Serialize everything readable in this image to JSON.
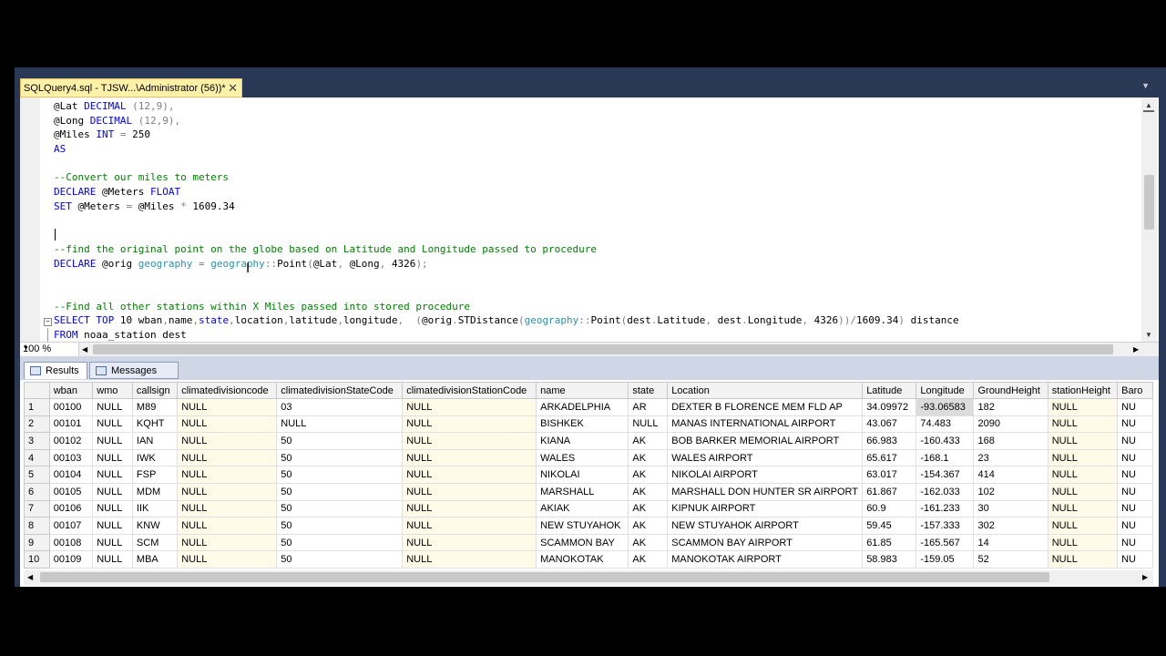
{
  "document_tab": {
    "title": "SQLQuery4.sql - TJSW...\\Administrator (56))*",
    "close": "✕"
  },
  "code_lines": [
    [
      {
        "t": "@Lat ",
        "c": "vr"
      },
      {
        "t": "DECIMAL",
        "c": "kw"
      },
      {
        "t": " (12,9),",
        "c": "op"
      }
    ],
    [
      {
        "t": "@Long ",
        "c": "vr"
      },
      {
        "t": "DECIMAL",
        "c": "kw"
      },
      {
        "t": " (12,9),",
        "c": "op"
      }
    ],
    [
      {
        "t": "@Miles ",
        "c": "vr"
      },
      {
        "t": "INT",
        "c": "kw"
      },
      {
        "t": " = ",
        "c": "op"
      },
      {
        "t": "250",
        "c": "vr"
      }
    ],
    [
      {
        "t": "AS",
        "c": "kw"
      }
    ],
    [],
    [
      {
        "t": "--Convert our miles to meters",
        "c": "cm"
      }
    ],
    [
      {
        "t": "DECLARE",
        "c": "kw"
      },
      {
        "t": " @Meters ",
        "c": "vr"
      },
      {
        "t": "FLOAT",
        "c": "kw"
      }
    ],
    [
      {
        "t": "SET",
        "c": "kw"
      },
      {
        "t": " @Meters ",
        "c": "vr"
      },
      {
        "t": "=",
        "c": "op"
      },
      {
        "t": " @Miles ",
        "c": "vr"
      },
      {
        "t": "*",
        "c": "op"
      },
      {
        "t": " 1609.34",
        "c": "vr"
      }
    ],
    [],
    [],
    [
      {
        "t": "--find the original point on the globe based on Latitude and Longitude passed to procedure",
        "c": "cm"
      }
    ],
    [
      {
        "t": "DECLARE",
        "c": "kw"
      },
      {
        "t": " @orig ",
        "c": "vr"
      },
      {
        "t": "geography",
        "c": "ty"
      },
      {
        "t": " = ",
        "c": "op"
      },
      {
        "t": "geography",
        "c": "ty"
      },
      {
        "t": "::",
        "c": "op"
      },
      {
        "t": "Point",
        "c": "vr"
      },
      {
        "t": "(",
        "c": "op"
      },
      {
        "t": "@Lat",
        "c": "vr"
      },
      {
        "t": ", ",
        "c": "op"
      },
      {
        "t": "@Long",
        "c": "vr"
      },
      {
        "t": ", ",
        "c": "op"
      },
      {
        "t": "4326",
        "c": "vr"
      },
      {
        "t": ");",
        "c": "op"
      }
    ],
    [],
    [],
    [
      {
        "t": "--Find all other stations within X Miles passed into stored procedure",
        "c": "cm"
      }
    ],
    [
      {
        "t": "SELECT TOP",
        "c": "kw"
      },
      {
        "t": " 10 wban",
        "c": "vr"
      },
      {
        "t": ",",
        "c": "op"
      },
      {
        "t": "name",
        "c": "vr"
      },
      {
        "t": ",",
        "c": "op"
      },
      {
        "t": "state",
        "c": "kw"
      },
      {
        "t": ",",
        "c": "op"
      },
      {
        "t": "location",
        "c": "vr"
      },
      {
        "t": ",",
        "c": "op"
      },
      {
        "t": "latitude",
        "c": "vr"
      },
      {
        "t": ",",
        "c": "op"
      },
      {
        "t": "longitude",
        "c": "vr"
      },
      {
        "t": ",  (",
        "c": "op"
      },
      {
        "t": "@orig",
        "c": "vr"
      },
      {
        "t": ".",
        "c": "op"
      },
      {
        "t": "STDistance",
        "c": "vr"
      },
      {
        "t": "(",
        "c": "op"
      },
      {
        "t": "geography",
        "c": "ty"
      },
      {
        "t": "::",
        "c": "op"
      },
      {
        "t": "Point",
        "c": "vr"
      },
      {
        "t": "(",
        "c": "op"
      },
      {
        "t": "dest",
        "c": "vr"
      },
      {
        "t": ".",
        "c": "op"
      },
      {
        "t": "Latitude",
        "c": "vr"
      },
      {
        "t": ", ",
        "c": "op"
      },
      {
        "t": "dest",
        "c": "vr"
      },
      {
        "t": ".",
        "c": "op"
      },
      {
        "t": "Longitude",
        "c": "vr"
      },
      {
        "t": ", ",
        "c": "op"
      },
      {
        "t": "4326",
        "c": "vr"
      },
      {
        "t": "))/",
        "c": "op"
      },
      {
        "t": "1609.34",
        "c": "vr"
      },
      {
        "t": ")",
        "c": "op"
      },
      {
        "t": " distance",
        "c": "vr"
      }
    ],
    [
      {
        "t": "FROM",
        "c": "kw"
      },
      {
        "t": " noaa_station dest",
        "c": "vr"
      }
    ]
  ],
  "zoom": {
    "value": "100 %"
  },
  "results_tabs": {
    "results": "Results",
    "messages": "Messages"
  },
  "grid": {
    "columns": [
      "wban",
      "wmo",
      "callsign",
      "climatedivisioncode",
      "climatedivisionStateCode",
      "climatedivisionStationCode",
      "name",
      "state",
      "Location",
      "Latitude",
      "Longitude",
      "GroundHeight",
      "stationHeight",
      "Baro"
    ],
    "rows": [
      [
        "1",
        "00100",
        "NULL",
        "M89",
        "NULL",
        "03",
        "NULL",
        "ARKADELPHIA",
        "AR",
        "DEXTER B FLORENCE MEM FLD AP",
        "34.09972",
        "-93.06583",
        "182",
        "NULL",
        "NU"
      ],
      [
        "2",
        "00101",
        "NULL",
        "KQHT",
        "NULL",
        "NULL",
        "NULL",
        "BISHKEK",
        "NULL",
        "MANAS INTERNATIONAL AIRPORT",
        "43.067",
        "74.483",
        "2090",
        "NULL",
        "NU"
      ],
      [
        "3",
        "00102",
        "NULL",
        "IAN",
        "NULL",
        "50",
        "NULL",
        "KIANA",
        "AK",
        "BOB BARKER MEMORIAL AIRPORT",
        "66.983",
        "-160.433",
        "168",
        "NULL",
        "NU"
      ],
      [
        "4",
        "00103",
        "NULL",
        "IWK",
        "NULL",
        "50",
        "NULL",
        "WALES",
        "AK",
        "WALES AIRPORT",
        "65.617",
        "-168.1",
        "23",
        "NULL",
        "NU"
      ],
      [
        "5",
        "00104",
        "NULL",
        "FSP",
        "NULL",
        "50",
        "NULL",
        "NIKOLAI",
        "AK",
        "NIKOLAI AIRPORT",
        "63.017",
        "-154.367",
        "414",
        "NULL",
        "NU"
      ],
      [
        "6",
        "00105",
        "NULL",
        "MDM",
        "NULL",
        "50",
        "NULL",
        "MARSHALL",
        "AK",
        "MARSHALL DON HUNTER SR AIRPORT",
        "61.867",
        "-162.033",
        "102",
        "NULL",
        "NU"
      ],
      [
        "7",
        "00106",
        "NULL",
        "IIK",
        "NULL",
        "50",
        "NULL",
        "AKIAK",
        "AK",
        "KIPNUK AIRPORT",
        "60.9",
        "-161.233",
        "30",
        "NULL",
        "NU"
      ],
      [
        "8",
        "00107",
        "NULL",
        "KNW",
        "NULL",
        "50",
        "NULL",
        "NEW STUYAHOK",
        "AK",
        "NEW STUYAHOK AIRPORT",
        "59.45",
        "-157.333",
        "302",
        "NULL",
        "NU"
      ],
      [
        "9",
        "00108",
        "NULL",
        "SCM",
        "NULL",
        "50",
        "NULL",
        "SCAMMON BAY",
        "AK",
        "SCAMMON BAY AIRPORT",
        "61.85",
        "-165.567",
        "14",
        "NULL",
        "NU"
      ],
      [
        "10",
        "00109",
        "NULL",
        "MBA",
        "NULL",
        "50",
        "NULL",
        "MANOKOTAK",
        "AK",
        "MANOKOTAK AIRPORT",
        "58.983",
        "-159.05",
        "52",
        "NULL",
        "NU"
      ]
    ]
  }
}
